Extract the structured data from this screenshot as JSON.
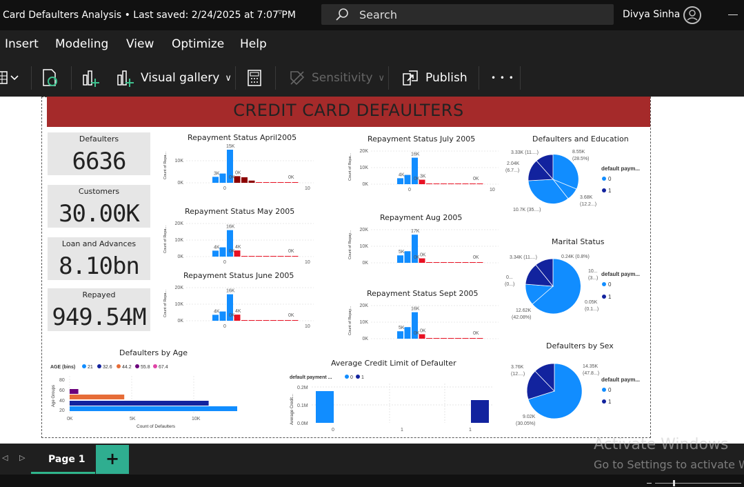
{
  "titlebar": {
    "title": "Card Defaulters Analysis  •  Last saved: 2/24/2025 at 7:07 PM",
    "search_placeholder": "Search",
    "user": "Divya Sinha"
  },
  "menu": {
    "items": [
      "Insert",
      "Modeling",
      "View",
      "Optimize",
      "Help"
    ]
  },
  "ribbon": {
    "visual_gallery": "Visual gallery",
    "sensitivity": "Sensitivity",
    "publish": "Publish",
    "more": "• • •"
  },
  "report": {
    "banner": "CREDIT CARD DEFAULTERS",
    "kpis": [
      {
        "label": "Defaulters",
        "value": "6636"
      },
      {
        "label": "Customers",
        "value": "30.00K"
      },
      {
        "label": "Loan and Advances",
        "value": "8.10bn"
      },
      {
        "label": "Repayed",
        "value": "949.54M"
      }
    ]
  },
  "chart_data": [
    {
      "type": "bar",
      "title": "Repayment Status April2005",
      "ylabel": "Count of Repa...",
      "yticks": [
        "0K",
        "10K"
      ],
      "xticks": [
        "0",
        "10"
      ],
      "data_labels": [
        "3K",
        "15K",
        "0K",
        "0K",
        "0K"
      ]
    },
    {
      "type": "bar",
      "title": "Repayment Status May 2005",
      "ylabel": "Count of Repa...",
      "yticks": [
        "0K",
        "10K",
        "20K"
      ],
      "xticks": [
        "0",
        "10"
      ],
      "data_labels": [
        "4K",
        "16K",
        "0K",
        "4K",
        "0K"
      ]
    },
    {
      "type": "bar",
      "title": "Repayment Status June 2005",
      "ylabel": "Count of Repa...",
      "yticks": [
        "0K",
        "10K",
        "20K"
      ],
      "xticks": [
        "0",
        "10"
      ],
      "data_labels": [
        "4K",
        "16K",
        "0K",
        "4K",
        "0K"
      ]
    },
    {
      "type": "bar",
      "title": "Repayment Status July 2005",
      "ylabel": "Count of Repa...",
      "yticks": [
        "0K",
        "10K",
        "20K"
      ],
      "xticks": [
        "0",
        "10"
      ],
      "data_labels": [
        "4K",
        "16K",
        "0K",
        "3K",
        "0K"
      ]
    },
    {
      "type": "bar",
      "title": "Repayment Aug 2005",
      "ylabel": "Count of Repay...",
      "yticks": [
        "0K",
        "10K",
        "20K"
      ],
      "xticks": [],
      "data_labels": [
        "5K",
        "17K",
        "0K",
        "0K",
        "0K"
      ]
    },
    {
      "type": "bar",
      "title": "Repayment Status Sept 2005",
      "ylabel": "Count of Repay...",
      "yticks": [
        "0K",
        "10K",
        "20K"
      ],
      "xticks": [],
      "data_labels": [
        "5K",
        "16K",
        "0K",
        "0K",
        "0K"
      ]
    },
    {
      "type": "bar",
      "title": "Defaulters by Age",
      "xlabel": "Count of Defaulters",
      "ylabel": "Age Groups",
      "legend_title": "AGE (bins)",
      "legend": [
        "21",
        "32.6",
        "44.2",
        "55.8",
        "67.4"
      ],
      "yticks": [
        "80",
        "60",
        "40",
        "20"
      ],
      "xticks": [
        "0K",
        "5K",
        "10K"
      ],
      "series": [
        {
          "name": "21",
          "values": [
            13500
          ]
        },
        {
          "name": "32.6",
          "values": [
            11200
          ]
        },
        {
          "name": "44.2",
          "values": [
            4400
          ]
        },
        {
          "name": "55.8",
          "values": [
            700
          ]
        },
        {
          "name": "67.4",
          "values": [
            0
          ]
        }
      ]
    },
    {
      "type": "bar",
      "title": "Average Credit Limit of Defaulter",
      "ylabel": "Average Credit...",
      "legend_title": "default payment ...",
      "legend": [
        "0",
        "1"
      ],
      "yticks": [
        "0.0M",
        "0.1M",
        "0.2M"
      ],
      "xticks": [
        "0",
        "1",
        "1"
      ]
    },
    {
      "type": "pie",
      "title": "Defaulters and Education",
      "legend_title": "default paym...",
      "legend": [
        "0",
        "1"
      ],
      "labels": [
        "8.55K",
        "(28.5%)",
        "3.33K (11....)",
        "2.04K",
        "(6.7...)",
        "3.68K",
        "(12.2...)",
        "10.7K (35....)"
      ]
    },
    {
      "type": "pie",
      "title": "Marital Status",
      "legend_title": "default paym...",
      "legend": [
        "0",
        "1"
      ],
      "labels": [
        "3.34K (11....)",
        "0.24K (0.8%)",
        "10...",
        "(3...)",
        "0...",
        "(0...)",
        "0.05K",
        "(0.1...)",
        "12.62K",
        "(42.08%)"
      ]
    },
    {
      "type": "pie",
      "title": "Defaulters by Sex",
      "legend_title": "default paym...",
      "legend": [
        "0",
        "1"
      ],
      "labels": [
        "3.76K",
        "(12....)",
        "14.35K",
        "(47.8...)",
        "9.02K",
        "(30.05%)"
      ]
    }
  ],
  "pages": {
    "current": "Page 1",
    "add": "+"
  },
  "watermark": {
    "line1": "Activate Windows",
    "line2": "Go to Settings to activate W"
  }
}
